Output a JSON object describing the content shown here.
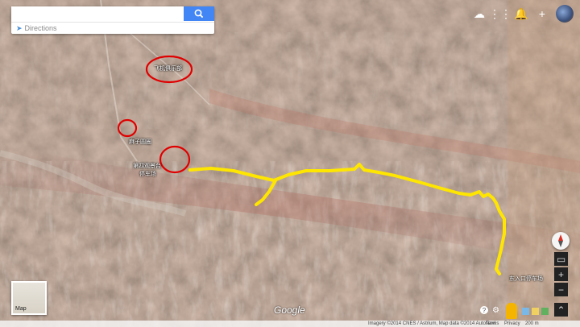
{
  "search": {
    "placeholder": "",
    "directions_label": "Directions"
  },
  "top_icons": [
    "camera-icon",
    "apps-grid-icon",
    "notifications-icon",
    "add-icon",
    "avatar"
  ],
  "labels": {
    "club": "飞机俱乐部",
    "mazi": "麻子圆圈",
    "viewpoint": "第四观景台",
    "parking": "停车场",
    "east_entrance": "东入口停车场"
  },
  "thumbnail_label": "Map",
  "google_logo": "Google",
  "attribution": "Imagery ©2014 CNES / Astrium, Map data ©2014 AutoNavi",
  "terms": "Terms",
  "privacy": "Privacy",
  "scale": "200 m",
  "colors": {
    "route": "#ffe600",
    "circle": "#e00000",
    "search_button": "#4285f4"
  }
}
